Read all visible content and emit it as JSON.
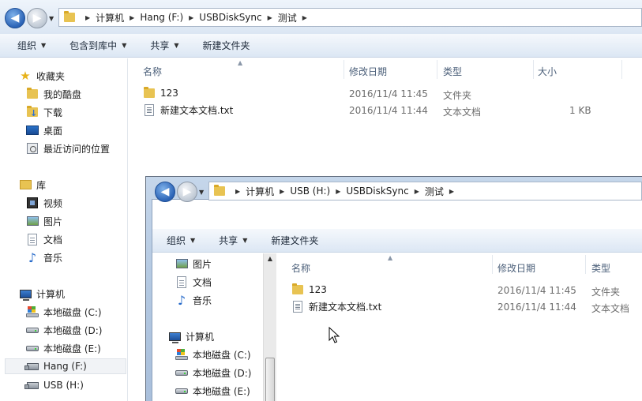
{
  "w1": {
    "breadcrumb": [
      "计算机",
      "Hang (F:)",
      "USBDiskSync",
      "测试"
    ],
    "toolbar": [
      "组织",
      "包含到库中",
      "共享",
      "新建文件夹"
    ],
    "sidebar": {
      "favorites": "收藏夹",
      "fav_items": [
        "我的酷盘",
        "下载",
        "桌面",
        "最近访问的位置"
      ],
      "libraries": "库",
      "lib_items": [
        "视频",
        "图片",
        "文档",
        "音乐"
      ],
      "computer": "计算机",
      "drives": [
        "本地磁盘 (C:)",
        "本地磁盘 (D:)",
        "本地磁盘 (E:)",
        "Hang (F:)",
        "USB (H:)"
      ]
    },
    "columns": [
      "名称",
      "修改日期",
      "类型",
      "大小"
    ],
    "files": [
      {
        "name": "123",
        "date": "2016/11/4 11:45",
        "type": "文件夹",
        "size": ""
      },
      {
        "name": "新建文本文档.txt",
        "date": "2016/11/4 11:44",
        "type": "文本文档",
        "size": "1 KB"
      }
    ]
  },
  "w2": {
    "breadcrumb": [
      "计算机",
      "USB (H:)",
      "USBDiskSync",
      "测试"
    ],
    "toolbar": [
      "组织",
      "共享",
      "新建文件夹"
    ],
    "sidebar": {
      "lib_items": [
        "图片",
        "文档",
        "音乐"
      ],
      "computer": "计算机",
      "drives": [
        "本地磁盘 (C:)",
        "本地磁盘 (D:)",
        "本地磁盘 (E:)"
      ]
    },
    "columns": [
      "名称",
      "修改日期",
      "类型"
    ],
    "files": [
      {
        "name": "123",
        "date": "2016/11/4 11:45",
        "type": "文件夹"
      },
      {
        "name": "新建文本文档.txt",
        "date": "2016/11/4 11:44",
        "type": "文本文档"
      }
    ]
  }
}
